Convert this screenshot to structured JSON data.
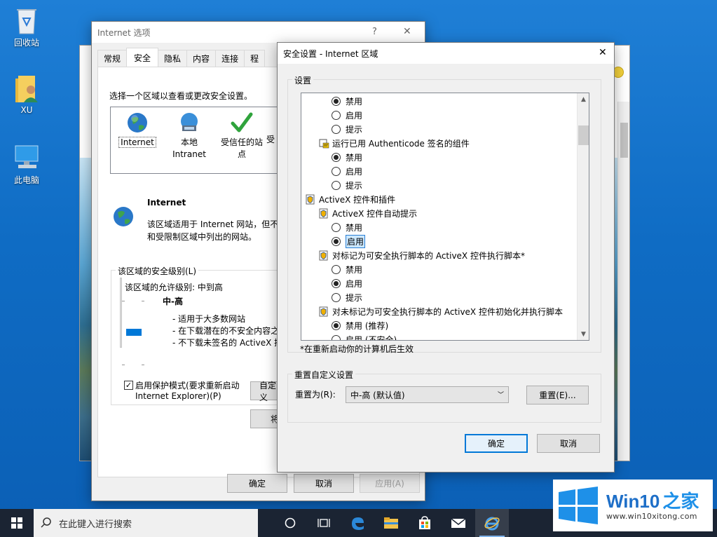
{
  "desktop": {
    "icons": [
      {
        "label": "回收站",
        "icon": "recycle-bin-icon"
      },
      {
        "label": "XU",
        "icon": "user-folder-icon"
      },
      {
        "label": "此电脑",
        "icon": "this-pc-icon"
      }
    ]
  },
  "internet_options": {
    "title": "Internet 选项",
    "title_buttons": {
      "help": "?",
      "close": "✕"
    },
    "tabs": [
      "常规",
      "安全",
      "隐私",
      "内容",
      "连接",
      "程"
    ],
    "active_tab": "安全",
    "zone_prompt": "选择一个区域以查看或更改安全设置。",
    "zones": [
      {
        "label": "Internet",
        "icon": "globe-icon"
      },
      {
        "label": "本地 Intranet",
        "label_line1": "本地",
        "label_line2": "Intranet",
        "icon": "intranet-icon"
      },
      {
        "label": "受信任的站点",
        "label_line1": "受信任的站",
        "label_line2": "点",
        "icon": "checkmark-icon"
      },
      {
        "label": "受",
        "icon": "restricted-icon"
      }
    ],
    "selected_zone": {
      "name": "Internet",
      "desc_line1": "该区域适用于 Internet 网站，但不",
      "desc_line2": "和受限制区域中列出的网站。"
    },
    "security_level": {
      "group_label": "该区域的安全级别(L)",
      "allowed_label": "该区域的允许级别: 中到高",
      "level_name": "中-高",
      "bullets": [
        "- 适用于大多数网站",
        "- 在下载潜在的不安全内容之",
        "- 不下载未签名的 ActiveX 控"
      ],
      "slider_level": "中-高"
    },
    "protected_mode": {
      "label_line1": "启用保护模式(要求重新启动",
      "label_line2": "Internet Explorer)(P)",
      "checked": true
    },
    "custom_button": "自定义",
    "default_button": "将",
    "ok": "确定",
    "cancel": "取消",
    "apply": "应用(A)"
  },
  "security_settings": {
    "title": "安全设置 - Internet 区域",
    "close": "✕",
    "group_label": "设置",
    "rows": [
      {
        "kind": "radio",
        "label": "禁用",
        "checked": true,
        "indent": 2
      },
      {
        "kind": "radio",
        "label": "启用",
        "checked": false,
        "indent": 2
      },
      {
        "kind": "radio",
        "label": "提示",
        "checked": false,
        "indent": 2
      },
      {
        "kind": "cert",
        "label": "运行已用 Authenticode 签名的组件",
        "indent": 1
      },
      {
        "kind": "radio",
        "label": "禁用",
        "checked": true,
        "indent": 2
      },
      {
        "kind": "radio",
        "label": "启用",
        "checked": false,
        "indent": 2
      },
      {
        "kind": "radio",
        "label": "提示",
        "checked": false,
        "indent": 2
      },
      {
        "kind": "shield",
        "label": "ActiveX 控件和插件",
        "indent": 0
      },
      {
        "kind": "shield",
        "label": "ActiveX 控件自动提示",
        "indent": 1
      },
      {
        "kind": "radio",
        "label": "禁用",
        "checked": false,
        "indent": 2
      },
      {
        "kind": "radio",
        "label": "启用",
        "checked": true,
        "indent": 2,
        "focused": true
      },
      {
        "kind": "shield",
        "label": "对标记为可安全执行脚本的 ActiveX 控件执行脚本*",
        "indent": 1
      },
      {
        "kind": "radio",
        "label": "禁用",
        "checked": false,
        "indent": 2
      },
      {
        "kind": "radio",
        "label": "启用",
        "checked": true,
        "indent": 2
      },
      {
        "kind": "radio",
        "label": "提示",
        "checked": false,
        "indent": 2
      },
      {
        "kind": "shield",
        "label": "对未标记为可安全执行脚本的 ActiveX 控件初始化并执行脚本",
        "indent": 1
      },
      {
        "kind": "radio",
        "label": "禁用 (推荐)",
        "checked": true,
        "indent": 2
      },
      {
        "kind": "radio",
        "label": "启用 (不安全)",
        "checked": false,
        "indent": 2
      }
    ],
    "restart_note": "*在重新启动你的计算机后生效",
    "reset_group_label": "重置自定义设置",
    "reset_to_label": "重置为(R):",
    "reset_select_value": "中-高 (默认值)",
    "reset_button": "重置(E)...",
    "ok": "确定",
    "cancel": "取消"
  },
  "taskbar": {
    "search_placeholder": "在此键入进行搜索",
    "icons": [
      "cortana-icon",
      "task-view-icon",
      "edge-icon",
      "file-explorer-icon",
      "store-icon",
      "mail-icon",
      "ie-icon"
    ]
  },
  "watermark": {
    "brand": "Win10",
    "brand_suffix": "之家",
    "url": "www.win10xitong.com"
  },
  "colors": {
    "accent": "#0078d7",
    "desktop": "#0f6cc4",
    "taskbar": "#1b2433"
  }
}
